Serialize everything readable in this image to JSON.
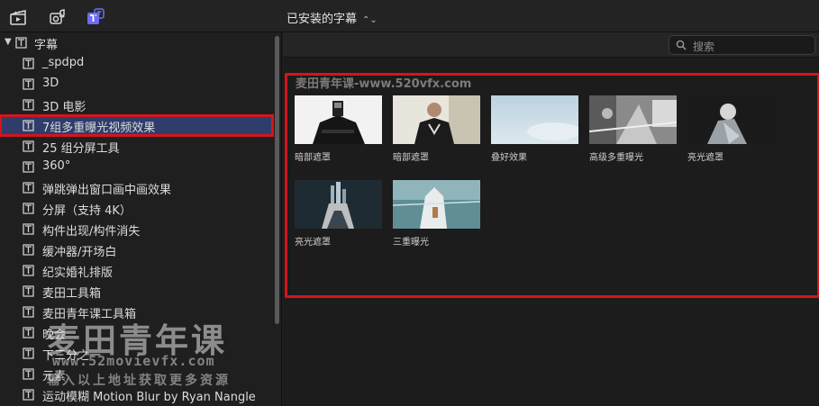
{
  "toolbar": {
    "icons": [
      "clapperboard-icon",
      "music-photos-icon",
      "titles-icon"
    ],
    "browser_title": "已安装的字幕",
    "browser_title_chevron": "⌃⌄"
  },
  "sidebar": {
    "root_label": "字幕",
    "items": [
      {
        "label": "_spdpd"
      },
      {
        "label": "3D"
      },
      {
        "label": "3D 电影"
      },
      {
        "label": "7组多重曝光视频效果",
        "selected": true
      },
      {
        "label": "25 组分屏工具"
      },
      {
        "label": "360°"
      },
      {
        "label": "弹跳弹出窗口画中画效果"
      },
      {
        "label": "分屏（支持 4K）"
      },
      {
        "label": "构件出现/构件消失"
      },
      {
        "label": "缓冲器/开场白"
      },
      {
        "label": "纪实婚礼排版"
      },
      {
        "label": "麦田工具箱"
      },
      {
        "label": "麦田青年课工具箱"
      },
      {
        "label": "晚会"
      },
      {
        "label": "下三分之一"
      },
      {
        "label": "元素"
      },
      {
        "label": "运动模糊 Motion Blur by Ryan Nangle"
      }
    ]
  },
  "watermark": {
    "title": "麦田青年课",
    "url": "www.52movievfx.com",
    "subtitle": "输入以上地址获取更多资源"
  },
  "search": {
    "placeholder": "搜索"
  },
  "group": {
    "title": "麦田青年课-www.520vfx.com",
    "items": [
      {
        "label": "暗部遮罩"
      },
      {
        "label": "暗部遮罩"
      },
      {
        "label": "叠好效果"
      },
      {
        "label": "高级多重曝光"
      },
      {
        "label": "亮光遮罩"
      },
      {
        "label": "亮光遮罩"
      },
      {
        "label": "三重曝光"
      }
    ]
  },
  "colors": {
    "highlight": "#d4151b",
    "selection": "#2f3d6b",
    "accent_icon": "#6e6cf0"
  }
}
